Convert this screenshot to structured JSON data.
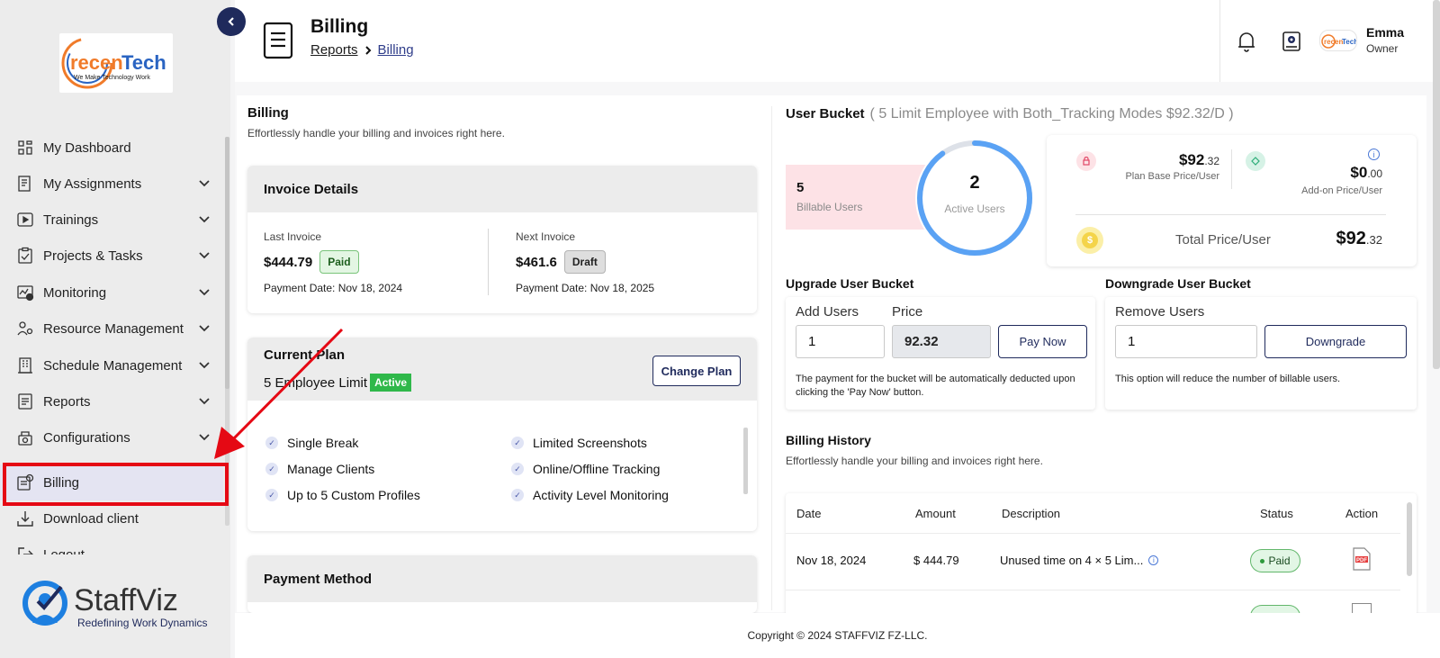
{
  "brand": {
    "name": "recenTech",
    "tagline": "We Make Technology Work",
    "product_name": "StaffViz",
    "product_tagline": "Redefining Work Dynamics"
  },
  "sidebar": {
    "items": [
      {
        "label": "My Dashboard",
        "icon": "dashboard-icon",
        "has_children": false,
        "active": false
      },
      {
        "label": "My Assignments",
        "icon": "assignments-icon",
        "has_children": true,
        "active": false
      },
      {
        "label": "Trainings",
        "icon": "play-icon",
        "has_children": true,
        "active": false
      },
      {
        "label": "Projects & Tasks",
        "icon": "clipboard-icon",
        "has_children": true,
        "active": false
      },
      {
        "label": "Monitoring",
        "icon": "monitoring-icon",
        "has_children": true,
        "active": false
      },
      {
        "label": "Resource Management",
        "icon": "people-gear-icon",
        "has_children": true,
        "active": false
      },
      {
        "label": "Schedule Management",
        "icon": "building-icon",
        "has_children": true,
        "active": false
      },
      {
        "label": "Reports",
        "icon": "report-icon",
        "has_children": true,
        "active": false
      },
      {
        "label": "Configurations",
        "icon": "config-icon",
        "has_children": true,
        "active": false
      },
      {
        "label": "Billing",
        "icon": "billing-icon",
        "has_children": false,
        "active": true
      },
      {
        "label": "Download client",
        "icon": "download-icon",
        "has_children": false,
        "active": false
      },
      {
        "label": "Logout",
        "icon": "logout-icon",
        "has_children": false,
        "active": false
      }
    ]
  },
  "header": {
    "title": "Billing",
    "breadcrumb": [
      "Reports",
      "Billing"
    ],
    "user_name": "Emma",
    "user_role": "Owner"
  },
  "billing": {
    "title": "Billing",
    "subtitle": "Effortlessly handle your billing and invoices right here."
  },
  "invoice": {
    "title": "Invoice Details",
    "last": {
      "label": "Last Invoice",
      "amount": "$444.79",
      "status": "Paid",
      "date": "Payment Date: Nov 18, 2024"
    },
    "next": {
      "label": "Next Invoice",
      "amount": "$461.6",
      "status": "Draft",
      "date": "Payment Date: Nov 18, 2025"
    }
  },
  "plan": {
    "title": "Current Plan",
    "name": "5 Employee Limit",
    "status": "Active",
    "change_label": "Change Plan",
    "features": [
      "Single Break",
      "Limited Screenshots",
      "Manage Clients",
      "Online/Offline Tracking",
      "Up to 5 Custom Profiles",
      "Activity Level Monitoring"
    ]
  },
  "payment_method": {
    "title": "Payment Method"
  },
  "bucket": {
    "title": "User Bucket",
    "detail": "( 5 Limit Employee with Both_Tracking Modes $92.32/D )",
    "billable_count": "5",
    "billable_label": "Billable Users",
    "active_count": "2",
    "active_label": "Active Users",
    "active_fraction": 0.9,
    "plan_base_price_main": "$92",
    "plan_base_price_dec": ".32",
    "plan_base_label": "Plan Base Price/User",
    "addon_price_main": "$0",
    "addon_price_dec": ".00",
    "addon_label": "Add-on Price/User",
    "total_label": "Total Price/User",
    "total_main": "$92",
    "total_dec": ".32"
  },
  "upgrade": {
    "title": "Upgrade User Bucket",
    "add_label": "Add Users",
    "add_value": "1",
    "price_label": "Price",
    "price_value": "92.32",
    "button": "Pay Now",
    "note_line1": "The payment for the bucket will be automatically deducted upon",
    "note_line2": "clicking the 'Pay Now' button."
  },
  "downgrade": {
    "title": "Downgrade User Bucket",
    "remove_label": "Remove Users",
    "remove_value": "1",
    "button": "Downgrade",
    "note": "This option will reduce the number of billable users."
  },
  "history": {
    "title": "Billing History",
    "subtitle": "Effortlessly handle your billing and invoices right here.",
    "columns": [
      "Date",
      "Amount",
      "Description",
      "Status",
      "Action"
    ],
    "rows": [
      {
        "date": "Nov 18, 2024",
        "amount": "$ 444.79",
        "description": "Unused time on 4 × 5 Lim...",
        "status": "Paid"
      }
    ]
  },
  "footer": {
    "copyright": "Copyright © 2024 STAFFVIZ FZ-LLC."
  },
  "colors": {
    "navy": "#1f2a5c",
    "red_highlight": "#e50914",
    "active_green": "#2fb84a",
    "ring_blue": "#5aa2f4"
  }
}
